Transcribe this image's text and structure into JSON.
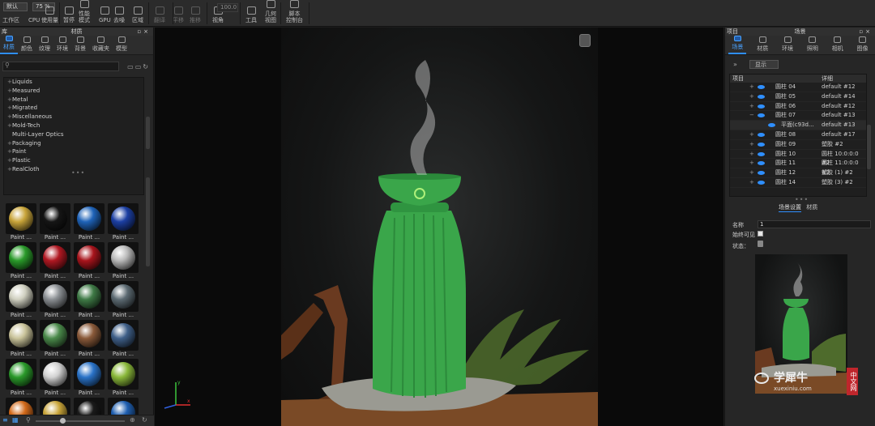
{
  "toolbar": {
    "preset": "默认",
    "zoom": "75 %",
    "items": [
      {
        "label": "工作区"
      },
      {
        "label": "CPU"
      },
      {
        "label": "使用量"
      },
      {
        "label": "暂停"
      },
      {
        "label": "性能\n模式"
      },
      {
        "label": "GPU"
      },
      {
        "label": "去噪"
      },
      {
        "label": "区域"
      },
      {
        "label": "翻译"
      },
      {
        "label": "平移"
      },
      {
        "label": "推移"
      },
      {
        "label": "视角"
      },
      {
        "label": "工具"
      },
      {
        "label": "几何\n视图"
      },
      {
        "label": "脚本\n控制台"
      }
    ],
    "fov_value": "100.0"
  },
  "left_panel": {
    "title": "材质",
    "corner": "库",
    "tabs": [
      "材质",
      "颜色",
      "纹理",
      "环境",
      "背景",
      "收藏夹",
      "模型"
    ],
    "categories": [
      "Liquids",
      "Measured",
      "Metal",
      "Migrated",
      "Miscellaneous",
      "Mold-Tech",
      "Multi-Layer Optics",
      "Packaging",
      "Paint",
      "Plastic",
      "RealCloth"
    ],
    "materials": [
      {
        "label": "Paint ...",
        "color": "#c9a53a"
      },
      {
        "label": "Paint ...",
        "color": "#151515"
      },
      {
        "label": "Paint ...",
        "color": "#1f63b8"
      },
      {
        "label": "Paint ...",
        "color": "#1c3fa3"
      },
      {
        "label": "Paint ...",
        "color": "#2a9a2a"
      },
      {
        "label": "Paint ...",
        "color": "#b01822"
      },
      {
        "label": "Paint ...",
        "color": "#a8141c"
      },
      {
        "label": "Paint ...",
        "color": "#b9b9b9"
      },
      {
        "label": "Paint ...",
        "color": "#cfcfbf"
      },
      {
        "label": "Paint ...",
        "color": "#8a8e92"
      },
      {
        "label": "Paint ...",
        "color": "#3f7a46"
      },
      {
        "label": "Paint ...",
        "color": "#5c6a72"
      },
      {
        "label": "Paint ...",
        "color": "#c9c39a"
      },
      {
        "label": "Paint ...",
        "color": "#4b8a4b"
      },
      {
        "label": "Paint ...",
        "color": "#8a5a3a"
      },
      {
        "label": "Paint ...",
        "color": "#3f5f88"
      },
      {
        "label": "Paint ...",
        "color": "#2a9a2a"
      },
      {
        "label": "Paint ...",
        "color": "#d2d2d2"
      },
      {
        "label": "Paint ...",
        "color": "#2a73c8"
      },
      {
        "label": "Paint ...",
        "color": "#8ab83a"
      },
      {
        "label": "Paint ...",
        "color": "#d36a1a"
      },
      {
        "label": "Paint ...",
        "color": "#c9a53a"
      },
      {
        "label": "Paint ...",
        "color": "#1a1a1a"
      },
      {
        "label": "Paint ...",
        "color": "#1f5fb0"
      }
    ]
  },
  "right_panel": {
    "corner": "项目",
    "title": "场景",
    "tabs": [
      "场景",
      "材质",
      "环境",
      "照明",
      "相机",
      "图像"
    ],
    "show_button": "显示",
    "columns": [
      "项目",
      "详细"
    ],
    "rows": [
      {
        "exp": "+",
        "name": "圆柱 04",
        "detail": "default #12"
      },
      {
        "exp": "+",
        "name": "圆柱 05",
        "detail": "default #14"
      },
      {
        "exp": "+",
        "name": "圆柱 06",
        "detail": "default #12"
      },
      {
        "exp": "−",
        "name": "圆柱 07",
        "detail": "default #13"
      },
      {
        "exp": "",
        "name": "平面(c93d...",
        "detail": "default #13",
        "sub": true
      },
      {
        "exp": "+",
        "name": "圆柱 08",
        "detail": "default #17"
      },
      {
        "exp": "+",
        "name": "圆柱 09",
        "detail": "塑胶 #2"
      },
      {
        "exp": "+",
        "name": "圆柱 10",
        "detail": "圆柱 10:0:0:0 #2"
      },
      {
        "exp": "+",
        "name": "圆柱 11",
        "detail": "圆柱 11:0:0:0 #2"
      },
      {
        "exp": "+",
        "name": "圆柱 12",
        "detail": "塑胶 (1) #2"
      },
      {
        "exp": "+",
        "name": "圆柱 14",
        "detail": "塑胶 (3) #2"
      }
    ],
    "subtabs": [
      "场景设置",
      "材质"
    ],
    "fields": {
      "name_label": "名称",
      "name_value": "1",
      "visible_label": "始终可见",
      "state_label": "状态："
    }
  },
  "watermark": {
    "brand": "学犀牛",
    "url": "xuexiniu.com",
    "badge": "中文网"
  },
  "colors": {
    "accent": "#2f8fff",
    "product_green": "#3aa64a"
  }
}
